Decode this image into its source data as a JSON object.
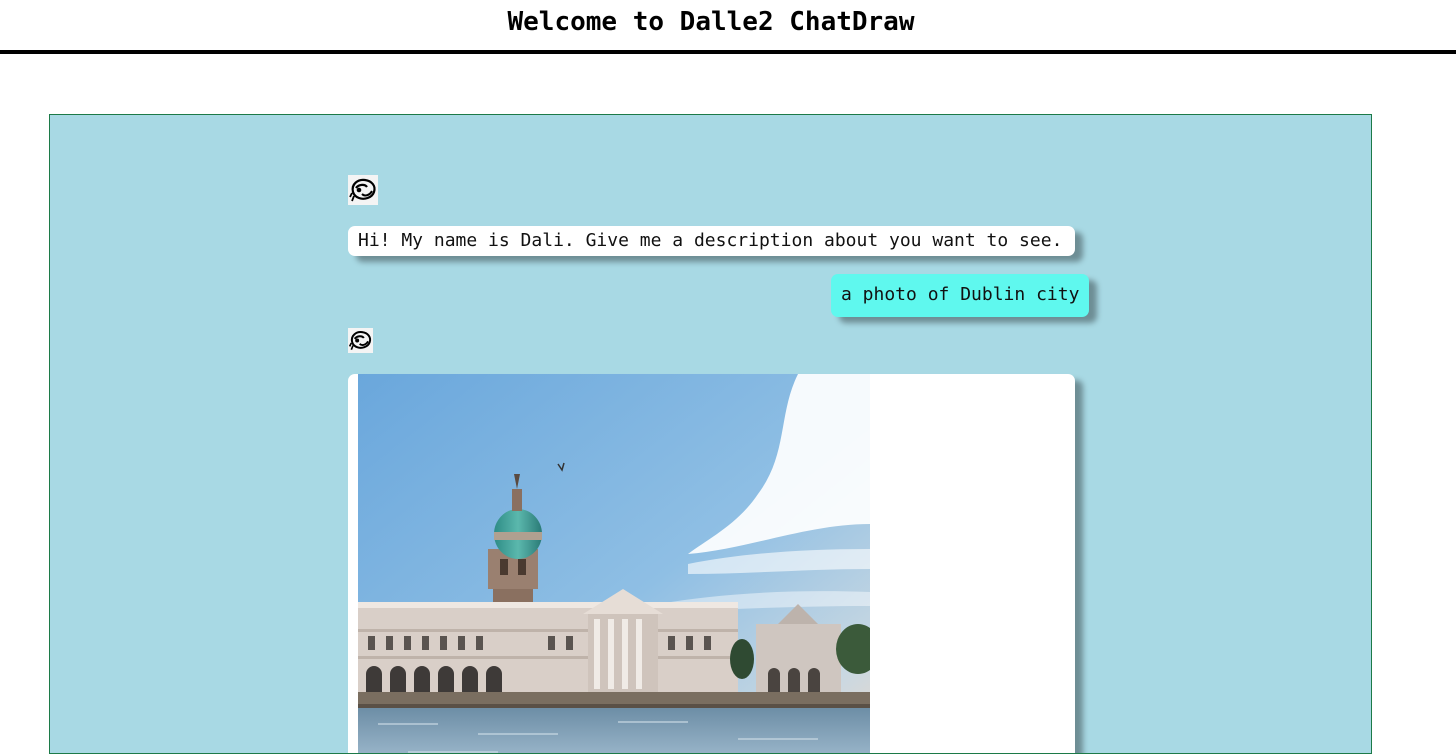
{
  "header": {
    "title": "Welcome to Dalle2 ChatDraw"
  },
  "chat": {
    "messages": [
      {
        "sender": "bot",
        "avatar_icon": "dali-avatar-icon",
        "text": "Hi! My name is Dali. Give me a description about you want to see."
      },
      {
        "sender": "user",
        "text": "a photo of Dublin city"
      },
      {
        "sender": "bot",
        "avatar_icon": "dali-avatar-icon",
        "image": "generated-dublin-image"
      }
    ]
  },
  "colors": {
    "chat_background": "#a8d9e4",
    "chat_border": "#1c7a48",
    "user_bubble": "#5ff8ee",
    "bot_bubble": "#ffffff"
  }
}
